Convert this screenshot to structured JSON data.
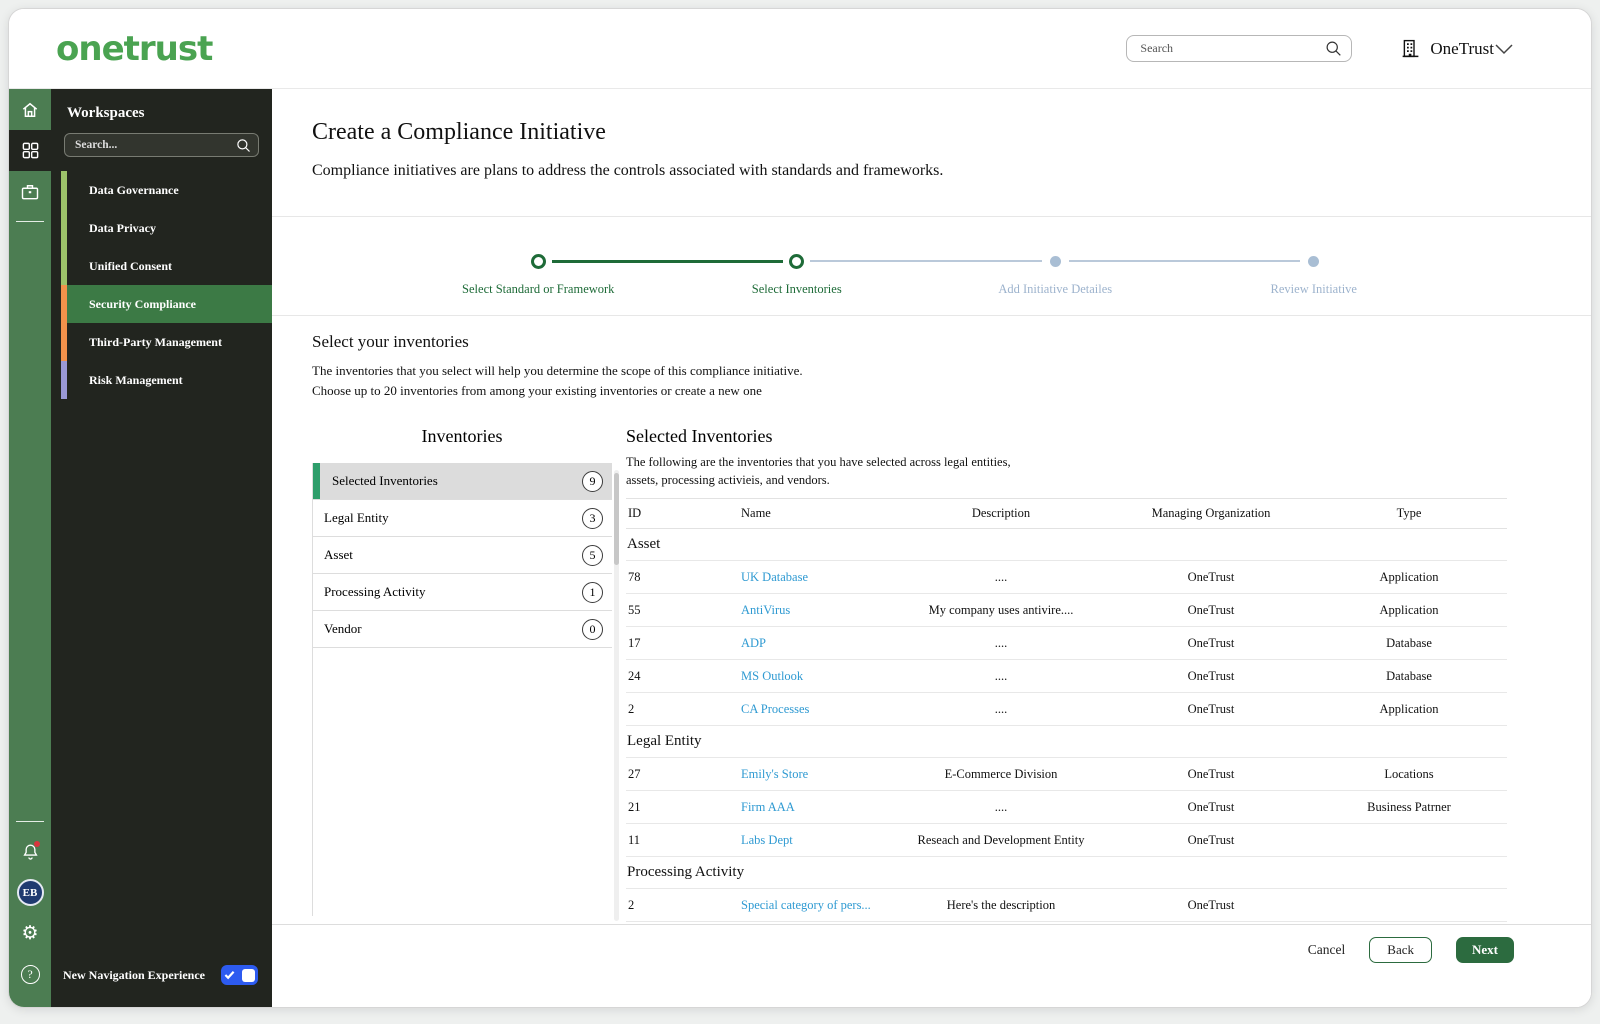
{
  "header": {
    "logo": "onetrust",
    "search_placeholder": "Search",
    "org_name": "OneTrust"
  },
  "sidebar": {
    "title": "Workspaces",
    "search_placeholder": "Search...",
    "items": [
      {
        "label": "Data Governance",
        "strip": "#9dc36a",
        "selected": false
      },
      {
        "label": "Data Privacy",
        "strip": "#9dc36a",
        "selected": false
      },
      {
        "label": "Unified Consent",
        "strip": "#9dc36a",
        "selected": false
      },
      {
        "label": "Security Compliance",
        "strip": "#f2924b",
        "selected": true
      },
      {
        "label": "Third-Party Management",
        "strip": "#f2924b",
        "selected": false
      },
      {
        "label": "Risk Management",
        "strip": "#9a99d6",
        "selected": false
      }
    ],
    "avatar_initials": "EB",
    "footer": {
      "toggle_label": "New Navigation Experience",
      "toggle_on": true
    }
  },
  "page": {
    "title": "Create a Compliance Initiative",
    "subtitle": "Compliance initiatives are plans to address the controls associated with standards and frameworks.",
    "stepper": [
      {
        "label": "Select Standard or Framework",
        "state": "done"
      },
      {
        "label": "Select Inventories",
        "state": "current"
      },
      {
        "label": "Add Initiative Detailes",
        "state": "upcoming"
      },
      {
        "label": "Review Initiative",
        "state": "upcoming"
      }
    ],
    "section": {
      "title": "Select your inventories",
      "description_line1": "The inventories that you select will help you determine the scope of this compliance initiative.",
      "description_line2": "Choose up to 20 inventories from among your existing inventories or create a new one"
    },
    "inventories_panel": {
      "title": "Inventories",
      "items": [
        {
          "label": "Selected Inventories",
          "count": "9",
          "selected": true
        },
        {
          "label": "Legal Entity",
          "count": "3",
          "selected": false
        },
        {
          "label": "Asset",
          "count": "5",
          "selected": false
        },
        {
          "label": "Processing Activity",
          "count": "1",
          "selected": false
        },
        {
          "label": "Vendor",
          "count": "0",
          "selected": false
        }
      ]
    },
    "selected_panel": {
      "title": "Selected Inventories",
      "description_line1": "The following are the inventories that you have selected across legal entities,",
      "description_line2": "assets, processing activieis, and vendors.",
      "table": {
        "columns": [
          "ID",
          "Name",
          "Description",
          "Managing Organization",
          "Type"
        ],
        "groups": [
          {
            "name": "Asset",
            "rows": [
              {
                "id": "78",
                "name": "UK Database",
                "description": "....",
                "org": "OneTrust",
                "type": "Application"
              },
              {
                "id": "55",
                "name": "AntiVirus",
                "description": "My company uses antivire....",
                "org": "OneTrust",
                "type": "Application"
              },
              {
                "id": "17",
                "name": "ADP",
                "description": "....",
                "org": "OneTrust",
                "type": "Database"
              },
              {
                "id": "24",
                "name": "MS Outlook",
                "description": "....",
                "org": "OneTrust",
                "type": "Database"
              },
              {
                "id": "2",
                "name": "CA Processes",
                "description": "....",
                "org": "OneTrust",
                "type": "Application"
              }
            ]
          },
          {
            "name": "Legal Entity",
            "rows": [
              {
                "id": "27",
                "name": "Emily's Store",
                "description": "E-Commerce Division",
                "org": "OneTrust",
                "type": "Locations"
              },
              {
                "id": "21",
                "name": "Firm AAA",
                "description": "....",
                "org": "OneTrust",
                "type": "Business Patrner"
              },
              {
                "id": "11",
                "name": "Labs Dept",
                "description": "Reseach and Development Entity",
                "org": "OneTrust",
                "type": ""
              }
            ]
          },
          {
            "name": "Processing Activity",
            "rows": [
              {
                "id": "2",
                "name": "Special category of pers...",
                "description": "Here's the description",
                "org": "OneTrust",
                "type": ""
              }
            ]
          }
        ]
      }
    },
    "footer": {
      "cancel": "Cancel",
      "back": "Back",
      "next": "Next"
    }
  },
  "colors": {
    "brand_green": "#4aa351",
    "rail_green": "#4c7d52",
    "panel_dark": "#22251f",
    "selected_workspace": "#3c7a45",
    "stepper_green": "#1e6b38",
    "stepper_inactive": "#a9bed4",
    "link_blue": "#2f9ad2",
    "toggle_blue": "#2d5bf0",
    "list_strip_green": "#2e9e6b"
  }
}
